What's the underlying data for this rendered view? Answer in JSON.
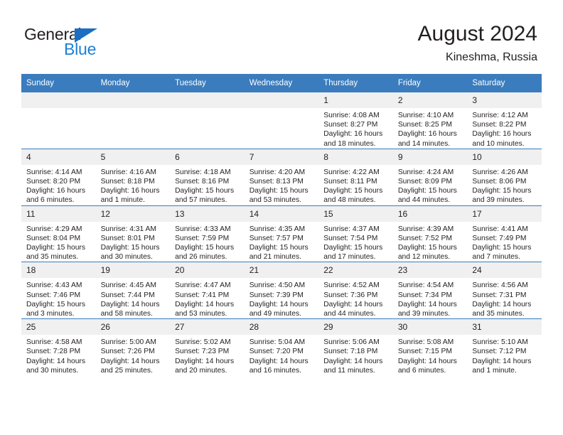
{
  "brand": {
    "word_one": "General",
    "word_two": "Blue",
    "triangle_color": "#1b6ec2",
    "blue_color": "#1b7fd4"
  },
  "header": {
    "title": "August 2024",
    "subtitle": "Kineshma, Russia"
  },
  "theme": {
    "header_blue": "#3a7cbe",
    "daynum_bg": "#f0f0f0",
    "text": "#231f20"
  },
  "weekdays": [
    "Sunday",
    "Monday",
    "Tuesday",
    "Wednesday",
    "Thursday",
    "Friday",
    "Saturday"
  ],
  "weeks": [
    [
      {
        "day": "",
        "empty": true
      },
      {
        "day": "",
        "empty": true
      },
      {
        "day": "",
        "empty": true
      },
      {
        "day": "",
        "empty": true
      },
      {
        "day": "1",
        "sunrise": "Sunrise: 4:08 AM",
        "sunset": "Sunset: 8:27 PM",
        "daylight_1": "Daylight: 16 hours",
        "daylight_2": "and 18 minutes."
      },
      {
        "day": "2",
        "sunrise": "Sunrise: 4:10 AM",
        "sunset": "Sunset: 8:25 PM",
        "daylight_1": "Daylight: 16 hours",
        "daylight_2": "and 14 minutes."
      },
      {
        "day": "3",
        "sunrise": "Sunrise: 4:12 AM",
        "sunset": "Sunset: 8:22 PM",
        "daylight_1": "Daylight: 16 hours",
        "daylight_2": "and 10 minutes."
      }
    ],
    [
      {
        "day": "4",
        "sunrise": "Sunrise: 4:14 AM",
        "sunset": "Sunset: 8:20 PM",
        "daylight_1": "Daylight: 16 hours",
        "daylight_2": "and 6 minutes."
      },
      {
        "day": "5",
        "sunrise": "Sunrise: 4:16 AM",
        "sunset": "Sunset: 8:18 PM",
        "daylight_1": "Daylight: 16 hours",
        "daylight_2": "and 1 minute."
      },
      {
        "day": "6",
        "sunrise": "Sunrise: 4:18 AM",
        "sunset": "Sunset: 8:16 PM",
        "daylight_1": "Daylight: 15 hours",
        "daylight_2": "and 57 minutes."
      },
      {
        "day": "7",
        "sunrise": "Sunrise: 4:20 AM",
        "sunset": "Sunset: 8:13 PM",
        "daylight_1": "Daylight: 15 hours",
        "daylight_2": "and 53 minutes."
      },
      {
        "day": "8",
        "sunrise": "Sunrise: 4:22 AM",
        "sunset": "Sunset: 8:11 PM",
        "daylight_1": "Daylight: 15 hours",
        "daylight_2": "and 48 minutes."
      },
      {
        "day": "9",
        "sunrise": "Sunrise: 4:24 AM",
        "sunset": "Sunset: 8:09 PM",
        "daylight_1": "Daylight: 15 hours",
        "daylight_2": "and 44 minutes."
      },
      {
        "day": "10",
        "sunrise": "Sunrise: 4:26 AM",
        "sunset": "Sunset: 8:06 PM",
        "daylight_1": "Daylight: 15 hours",
        "daylight_2": "and 39 minutes."
      }
    ],
    [
      {
        "day": "11",
        "sunrise": "Sunrise: 4:29 AM",
        "sunset": "Sunset: 8:04 PM",
        "daylight_1": "Daylight: 15 hours",
        "daylight_2": "and 35 minutes."
      },
      {
        "day": "12",
        "sunrise": "Sunrise: 4:31 AM",
        "sunset": "Sunset: 8:01 PM",
        "daylight_1": "Daylight: 15 hours",
        "daylight_2": "and 30 minutes."
      },
      {
        "day": "13",
        "sunrise": "Sunrise: 4:33 AM",
        "sunset": "Sunset: 7:59 PM",
        "daylight_1": "Daylight: 15 hours",
        "daylight_2": "and 26 minutes."
      },
      {
        "day": "14",
        "sunrise": "Sunrise: 4:35 AM",
        "sunset": "Sunset: 7:57 PM",
        "daylight_1": "Daylight: 15 hours",
        "daylight_2": "and 21 minutes."
      },
      {
        "day": "15",
        "sunrise": "Sunrise: 4:37 AM",
        "sunset": "Sunset: 7:54 PM",
        "daylight_1": "Daylight: 15 hours",
        "daylight_2": "and 17 minutes."
      },
      {
        "day": "16",
        "sunrise": "Sunrise: 4:39 AM",
        "sunset": "Sunset: 7:52 PM",
        "daylight_1": "Daylight: 15 hours",
        "daylight_2": "and 12 minutes."
      },
      {
        "day": "17",
        "sunrise": "Sunrise: 4:41 AM",
        "sunset": "Sunset: 7:49 PM",
        "daylight_1": "Daylight: 15 hours",
        "daylight_2": "and 7 minutes."
      }
    ],
    [
      {
        "day": "18",
        "sunrise": "Sunrise: 4:43 AM",
        "sunset": "Sunset: 7:46 PM",
        "daylight_1": "Daylight: 15 hours",
        "daylight_2": "and 3 minutes."
      },
      {
        "day": "19",
        "sunrise": "Sunrise: 4:45 AM",
        "sunset": "Sunset: 7:44 PM",
        "daylight_1": "Daylight: 14 hours",
        "daylight_2": "and 58 minutes."
      },
      {
        "day": "20",
        "sunrise": "Sunrise: 4:47 AM",
        "sunset": "Sunset: 7:41 PM",
        "daylight_1": "Daylight: 14 hours",
        "daylight_2": "and 53 minutes."
      },
      {
        "day": "21",
        "sunrise": "Sunrise: 4:50 AM",
        "sunset": "Sunset: 7:39 PM",
        "daylight_1": "Daylight: 14 hours",
        "daylight_2": "and 49 minutes."
      },
      {
        "day": "22",
        "sunrise": "Sunrise: 4:52 AM",
        "sunset": "Sunset: 7:36 PM",
        "daylight_1": "Daylight: 14 hours",
        "daylight_2": "and 44 minutes."
      },
      {
        "day": "23",
        "sunrise": "Sunrise: 4:54 AM",
        "sunset": "Sunset: 7:34 PM",
        "daylight_1": "Daylight: 14 hours",
        "daylight_2": "and 39 minutes."
      },
      {
        "day": "24",
        "sunrise": "Sunrise: 4:56 AM",
        "sunset": "Sunset: 7:31 PM",
        "daylight_1": "Daylight: 14 hours",
        "daylight_2": "and 35 minutes."
      }
    ],
    [
      {
        "day": "25",
        "sunrise": "Sunrise: 4:58 AM",
        "sunset": "Sunset: 7:28 PM",
        "daylight_1": "Daylight: 14 hours",
        "daylight_2": "and 30 minutes."
      },
      {
        "day": "26",
        "sunrise": "Sunrise: 5:00 AM",
        "sunset": "Sunset: 7:26 PM",
        "daylight_1": "Daylight: 14 hours",
        "daylight_2": "and 25 minutes."
      },
      {
        "day": "27",
        "sunrise": "Sunrise: 5:02 AM",
        "sunset": "Sunset: 7:23 PM",
        "daylight_1": "Daylight: 14 hours",
        "daylight_2": "and 20 minutes."
      },
      {
        "day": "28",
        "sunrise": "Sunrise: 5:04 AM",
        "sunset": "Sunset: 7:20 PM",
        "daylight_1": "Daylight: 14 hours",
        "daylight_2": "and 16 minutes."
      },
      {
        "day": "29",
        "sunrise": "Sunrise: 5:06 AM",
        "sunset": "Sunset: 7:18 PM",
        "daylight_1": "Daylight: 14 hours",
        "daylight_2": "and 11 minutes."
      },
      {
        "day": "30",
        "sunrise": "Sunrise: 5:08 AM",
        "sunset": "Sunset: 7:15 PM",
        "daylight_1": "Daylight: 14 hours",
        "daylight_2": "and 6 minutes."
      },
      {
        "day": "31",
        "sunrise": "Sunrise: 5:10 AM",
        "sunset": "Sunset: 7:12 PM",
        "daylight_1": "Daylight: 14 hours",
        "daylight_2": "and 1 minute."
      }
    ]
  ]
}
